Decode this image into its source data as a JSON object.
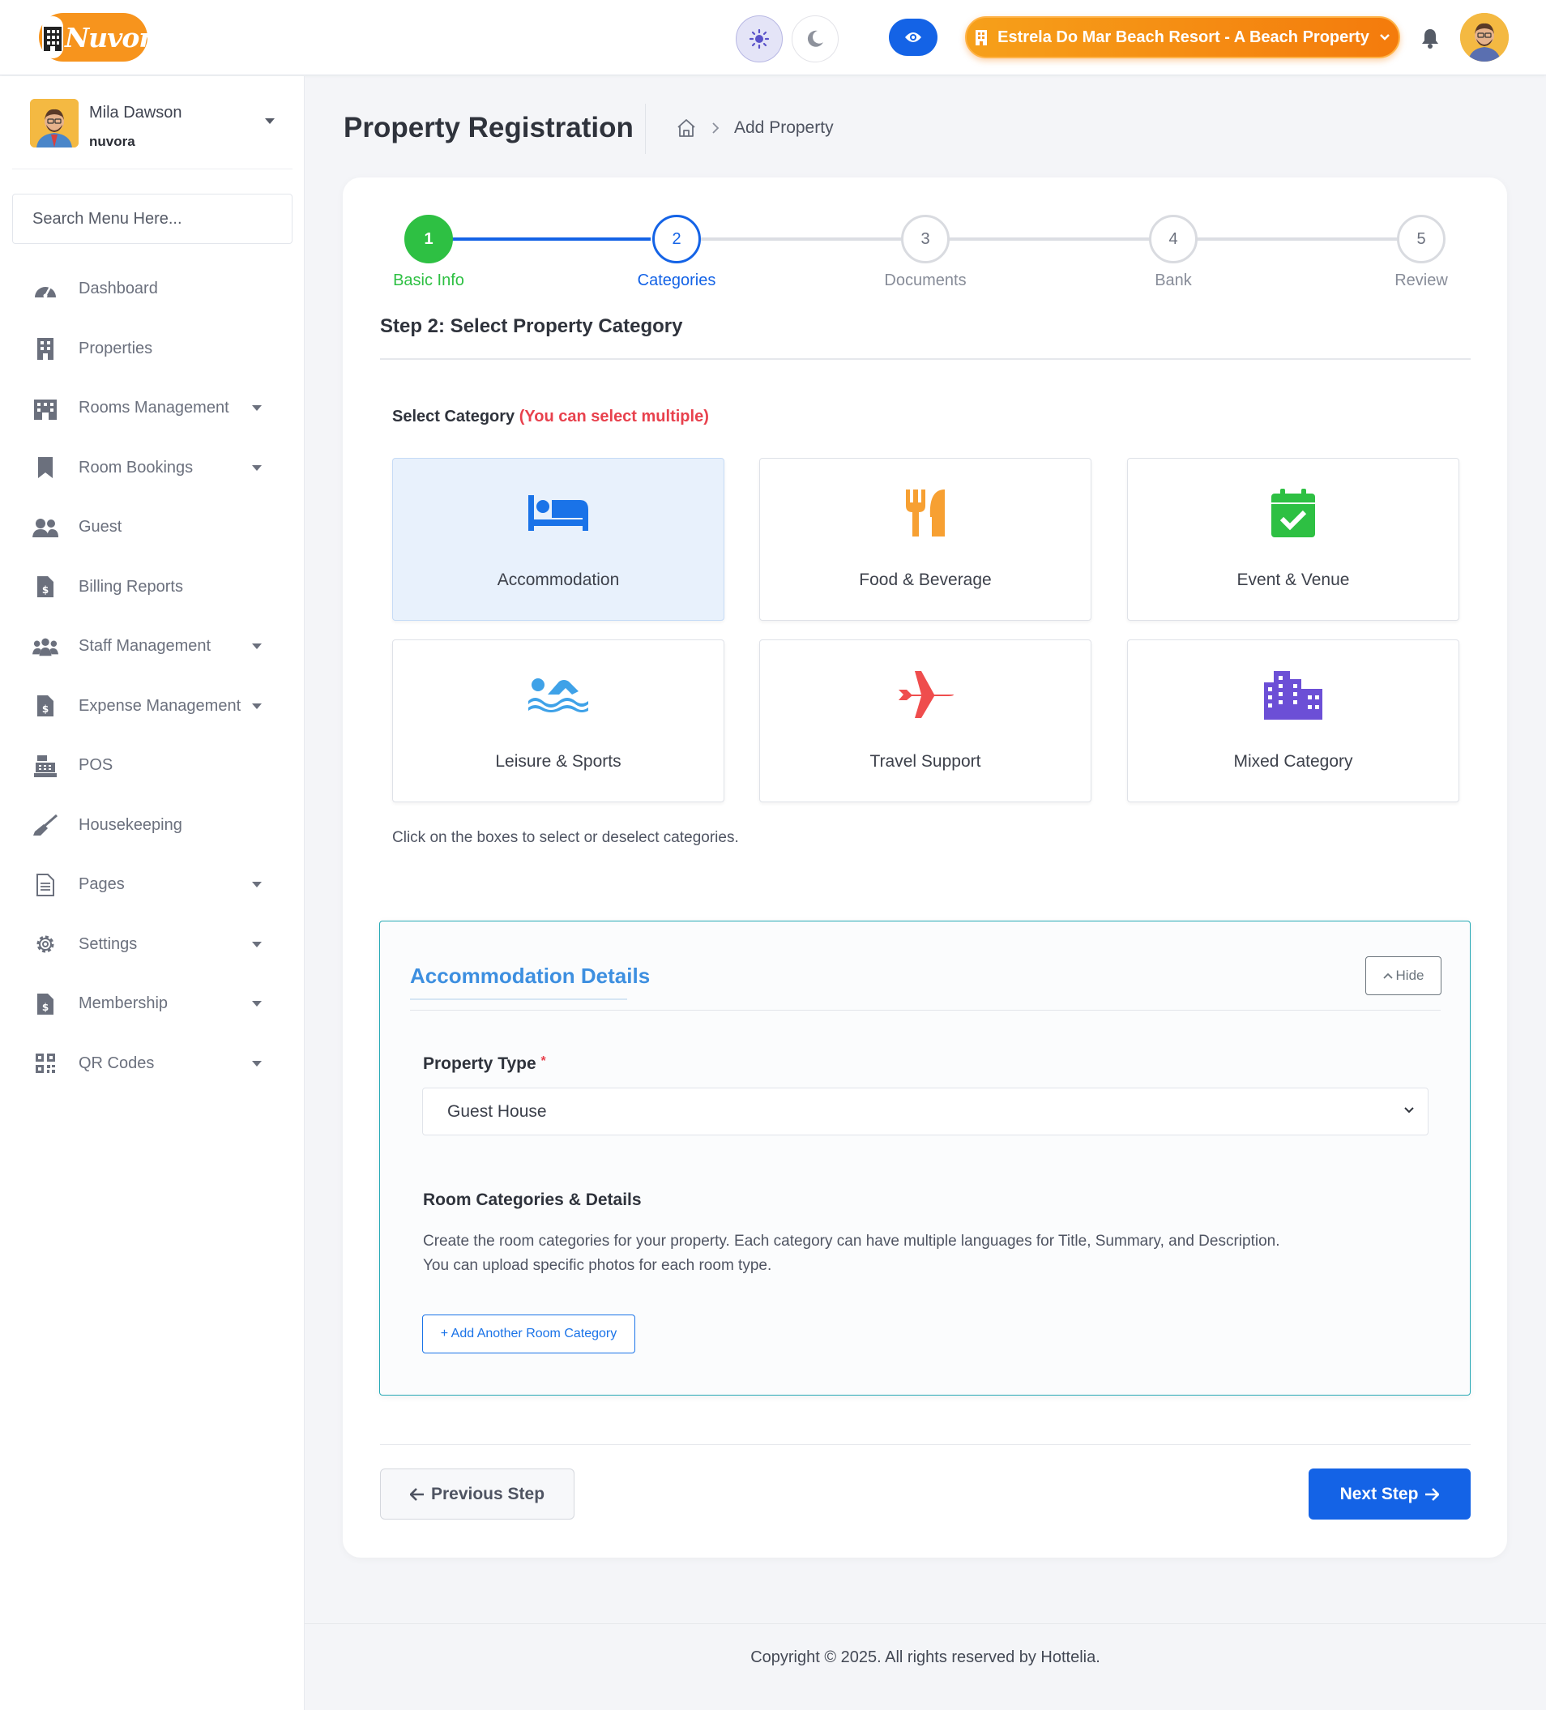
{
  "header": {
    "logo_text": "Nuvora",
    "property_selector": "Estrela Do Mar Beach Resort - A Beach Property"
  },
  "sidebar": {
    "user": {
      "name": "Mila Dawson",
      "org": "nuvora"
    },
    "search_placeholder": "Search Menu Here...",
    "items": [
      {
        "label": "Dashboard",
        "icon": "dashboard-icon"
      },
      {
        "label": "Properties",
        "icon": "building-icon"
      },
      {
        "label": "Rooms Management",
        "icon": "hotel-icon"
      },
      {
        "label": "Room Bookings",
        "icon": "bookmark-icon"
      },
      {
        "label": "Guest",
        "icon": "users-icon"
      },
      {
        "label": "Billing Reports",
        "icon": "invoice-icon"
      },
      {
        "label": "Staff Management",
        "icon": "staff-icon"
      },
      {
        "label": "Expense Management",
        "icon": "invoice-icon"
      },
      {
        "label": "POS",
        "icon": "cash-register-icon"
      },
      {
        "label": "Housekeeping",
        "icon": "broom-icon"
      },
      {
        "label": "Pages",
        "icon": "page-icon"
      },
      {
        "label": "Settings",
        "icon": "gear-icon"
      },
      {
        "label": "Membership",
        "icon": "invoice-icon"
      },
      {
        "label": "QR Codes",
        "icon": "qr-code-icon"
      }
    ]
  },
  "page": {
    "title": "Property Registration",
    "breadcrumb_current": "Add Property"
  },
  "stepper": {
    "steps": [
      {
        "number": "1",
        "label": "Basic Info",
        "state": "done"
      },
      {
        "number": "2",
        "label": "Categories",
        "state": "active"
      },
      {
        "number": "3",
        "label": "Documents",
        "state": "pending"
      },
      {
        "number": "4",
        "label": "Bank",
        "state": "pending"
      },
      {
        "number": "5",
        "label": "Review",
        "state": "pending"
      }
    ],
    "heading": "Step 2: Select Property Category"
  },
  "categories": {
    "label": "Select Category",
    "hint": "(You can select multiple)",
    "items": [
      {
        "label": "Accommodation",
        "icon": "bed-icon",
        "color": "#1a73e8",
        "selected": true
      },
      {
        "label": "Food & Beverage",
        "icon": "utensils-icon",
        "color": "#f7a032",
        "selected": false
      },
      {
        "label": "Event & Venue",
        "icon": "calendar-check-icon",
        "color": "#2ec043",
        "selected": false
      },
      {
        "label": "Leisure & Sports",
        "icon": "swimmer-icon",
        "color": "#3fa2e8",
        "selected": false
      },
      {
        "label": "Travel Support",
        "icon": "plane-icon",
        "color": "#ef4d4d",
        "selected": false
      },
      {
        "label": "Mixed Category",
        "icon": "city-icon",
        "color": "#6c4fd6",
        "selected": false
      }
    ],
    "note": "Click on the boxes to select or deselect categories."
  },
  "accommodation": {
    "title": "Accommodation Details",
    "hide_label": "Hide",
    "property_type_label": "Property Type",
    "required_mark": "*",
    "property_type_value": "Guest House",
    "room_title": "Room Categories & Details",
    "room_desc_1": "Create the room categories for your property. Each category can have multiple languages for Title, Summary, and Description.",
    "room_desc_2": "You can upload specific photos for each room type.",
    "add_room_label": "+ Add Another Room Category"
  },
  "nav": {
    "prev_label": "Previous Step",
    "next_label": "Next Step"
  },
  "footer": {
    "copyright": "Copyright © 2025. All rights reserved by Hottelia."
  },
  "colors": {
    "primary": "#1463e6",
    "success": "#2ec043",
    "accent_orange": "#f7941d",
    "danger": "#e8414d"
  }
}
